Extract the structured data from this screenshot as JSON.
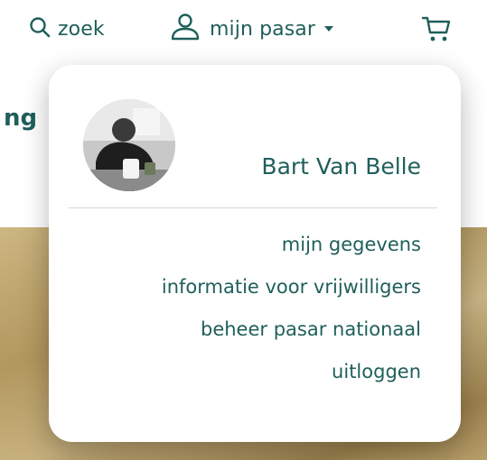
{
  "header": {
    "search_label": "zoek",
    "account_label": "mijn pasar",
    "icons": {
      "search": "search-icon",
      "account": "user-icon",
      "caret": "caret-down-icon",
      "cart": "cart-icon"
    }
  },
  "background": {
    "heading_fragment": "ng"
  },
  "dropdown": {
    "user_name": "Bart Van Belle",
    "menu": [
      {
        "label": "mijn gegevens"
      },
      {
        "label": "informatie voor vrijwilligers"
      },
      {
        "label": "beheer pasar nationaal"
      },
      {
        "label": "uitloggen"
      }
    ]
  },
  "colors": {
    "primary_teal": "#1f5f5b",
    "background": "#ffffff"
  }
}
